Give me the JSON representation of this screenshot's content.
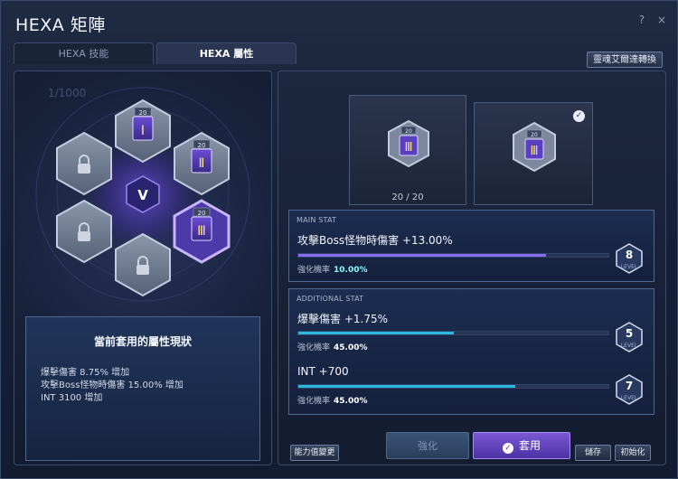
{
  "window": {
    "title": "HEXA 矩陣",
    "help_icon": "?",
    "close_icon": "×"
  },
  "tabs": [
    {
      "label": "HEXA 技能",
      "active": false
    },
    {
      "label": "HEXA 屬性",
      "active": true
    }
  ],
  "convert_button": "靈魂艾爾達轉換",
  "left": {
    "faded_text": "1/1000",
    "center_icon": "v-emblem-icon",
    "nodes": [
      {
        "numeral": "Ⅰ",
        "level": "20",
        "locked": false
      },
      {
        "numeral": "Ⅱ",
        "level": "20",
        "locked": false
      },
      {
        "numeral": "Ⅲ",
        "level": "20",
        "locked": false,
        "selected": true
      },
      {
        "locked": true
      },
      {
        "locked": true
      },
      {
        "locked": true
      }
    ],
    "summary": {
      "title": "當前套用的屬性現狀",
      "lines": [
        "爆擊傷害 8.75% 增加",
        "攻擊Boss怪物時傷害 15.00% 增加",
        "INT 3100 增加"
      ]
    }
  },
  "cards": [
    {
      "numeral": "Ⅲ",
      "level": "20",
      "caption": "20 / 20"
    },
    {
      "numeral": "Ⅲ",
      "level": "20",
      "checked": true
    }
  ],
  "main_stat": {
    "heading": "MAIN STAT",
    "name": "攻擊Boss怪物時傷害 +13.00%",
    "rate_label": "強化機率",
    "rate_value": "10.00%",
    "level": "8",
    "level_word": "LEVEL",
    "progress": 0.8,
    "color": "#8a6cf2"
  },
  "additional_stat": {
    "heading": "ADDITIONAL STAT",
    "items": [
      {
        "name": "爆擊傷害 +1.75%",
        "rate_label": "強化機率",
        "rate_value": "45.00%",
        "level": "5",
        "level_word": "LEVEL",
        "progress": 0.5
      },
      {
        "name": "INT +700",
        "rate_label": "強化機率",
        "rate_value": "45.00%",
        "level": "7",
        "level_word": "LEVEL",
        "progress": 0.7
      }
    ],
    "color": "#2bb8e0"
  },
  "buttons": {
    "change_stat": "能力值變更",
    "enhance": "強化",
    "apply": "套用",
    "save": "儲存",
    "reset": "初始化"
  }
}
